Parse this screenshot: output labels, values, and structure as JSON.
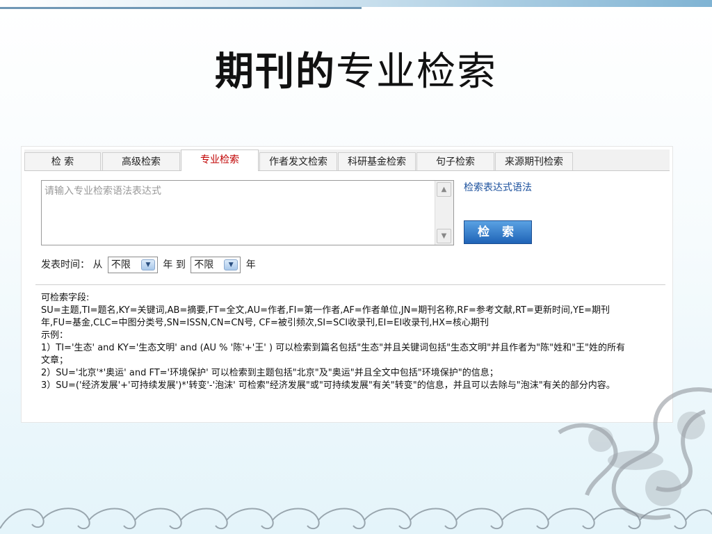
{
  "slide": {
    "title_bold": "期刊的",
    "title_rest": "专业检索"
  },
  "tabs": [
    {
      "label": "检 索"
    },
    {
      "label": "高级检索"
    },
    {
      "label": "专业检索"
    },
    {
      "label": "作者发文检索"
    },
    {
      "label": "科研基金检索"
    },
    {
      "label": "句子检索"
    },
    {
      "label": "来源期刊检索"
    }
  ],
  "query": {
    "placeholder": "请输入专业检索语法表达式"
  },
  "syntax_link": "检索表达式语法",
  "search_button": "检 索",
  "date": {
    "label": "发表时间：",
    "from": "从",
    "from_value": "不限",
    "year1": "年",
    "to": "到",
    "to_value": "不限",
    "year2": "年"
  },
  "help": {
    "fields_title": "可检索字段:",
    "fields_line1": "SU=主题,TI=题名,KY=关键词,AB=摘要,FT=全文,AU=作者,FI=第一作者,AF=作者单位,JN=期刊名称,RF=参考文献,RT=更新时间,YE=期刊",
    "fields_line2": "年,FU=基金,CLC=中图分类号,SN=ISSN,CN=CN号, CF=被引频次,SI=SCI收录刊,EI=EI收录刊,HX=核心期刊",
    "example_title": "示例：",
    "ex1_line1": "1）TI='生态' and KY='生态文明' and (AU % '陈'+'王' ) 可以检索到篇名包括\"生态\"并且关键词包括\"生态文明\"并且作者为\"陈\"姓和\"王\"姓的所有",
    "ex1_line2": "文章；",
    "ex2": "2）SU='北京'*'奥运' and FT='环境保护' 可以检索到主题包括\"北京\"及\"奥运\"并且全文中包括\"环境保护\"的信息；",
    "ex3": "3）SU=('经济发展'+'可持续发展')*'转变'-'泡沫' 可检索\"经济发展\"或\"可持续发展\"有关\"转变\"的信息，并且可以去除与\"泡沫\"有关的部分内容。"
  },
  "colors": {
    "active_tab": "#c00000",
    "link": "#1a4f9c",
    "button": "#1f63b7"
  },
  "icons": {
    "scroll_up": "chevron-up-icon",
    "scroll_down": "chevron-down-icon",
    "dropdown": "chevron-down-icon"
  }
}
